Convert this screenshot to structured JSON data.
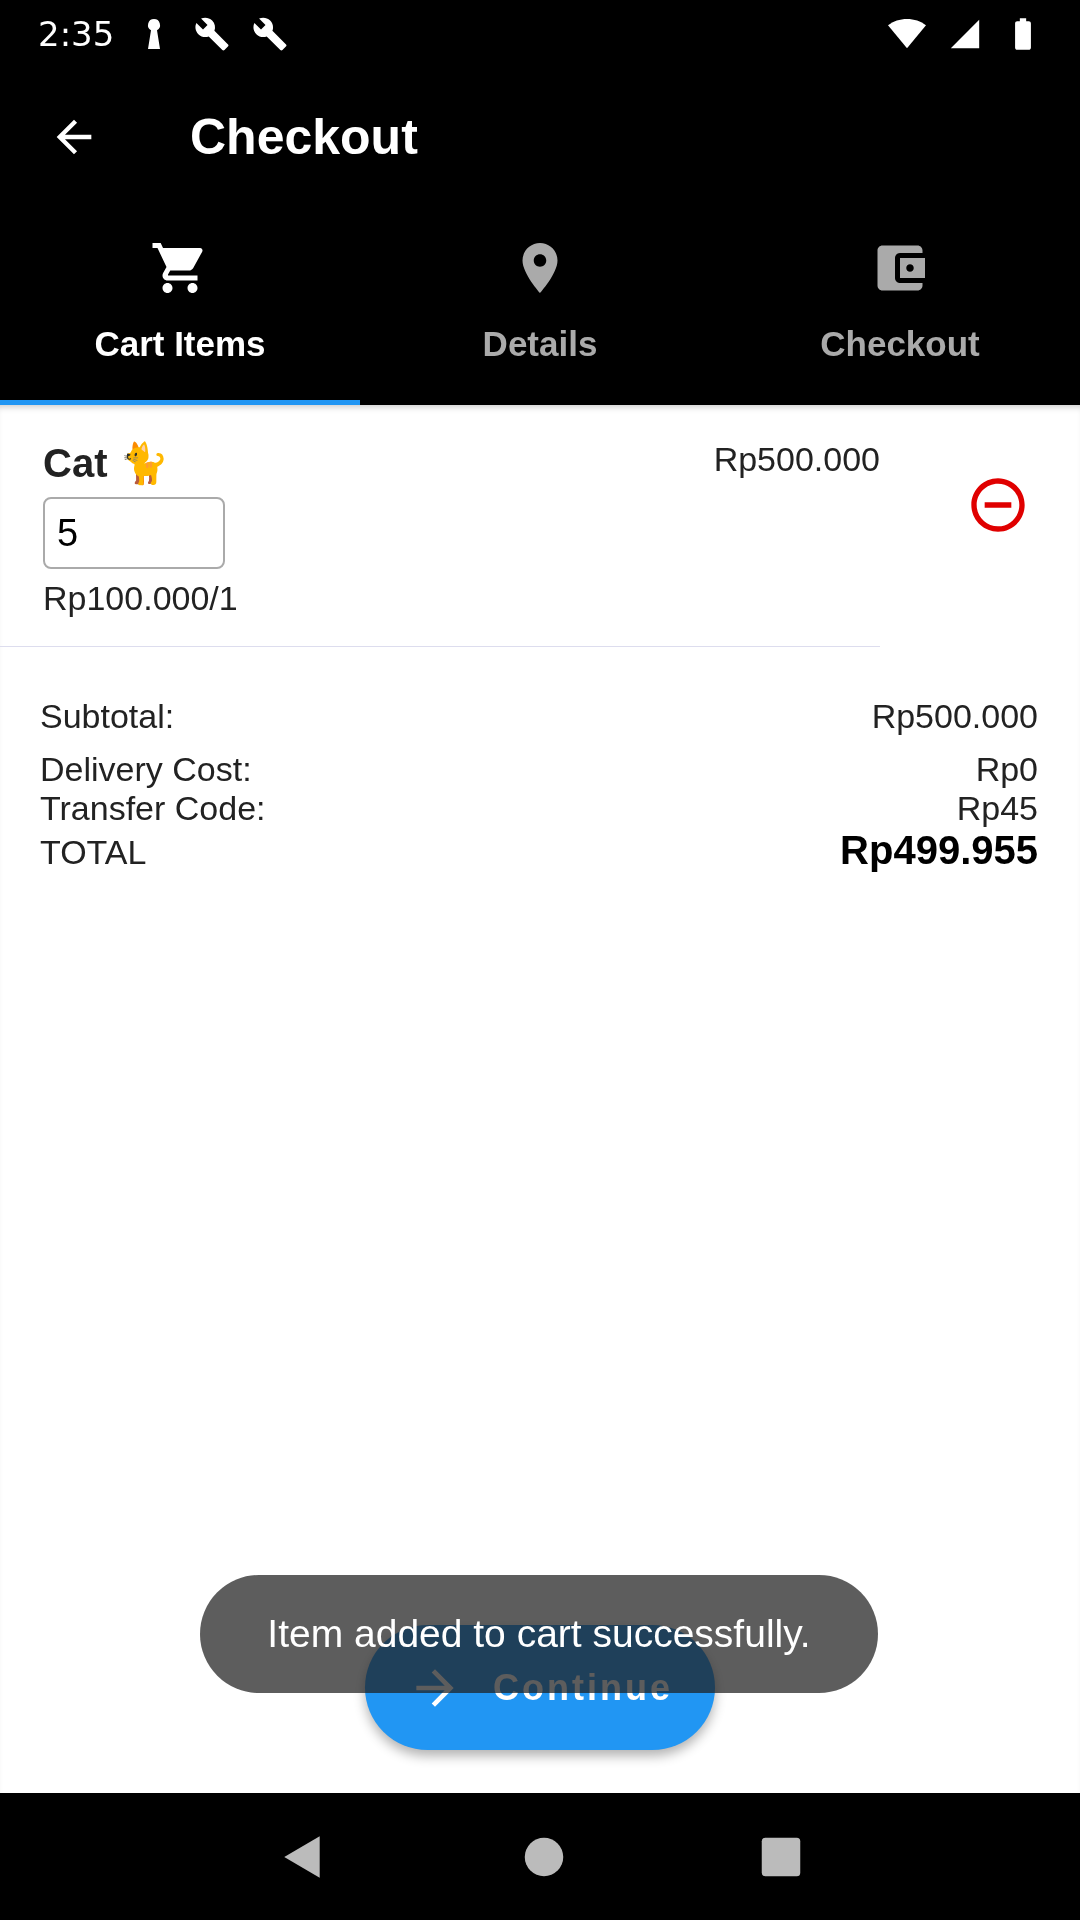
{
  "status_bar": {
    "time": "2:35"
  },
  "app_bar": {
    "title": "Checkout"
  },
  "tabs": [
    {
      "label": "Cart Items",
      "kind": "cart",
      "selected": true
    },
    {
      "label": "Details",
      "kind": "place",
      "selected": false
    },
    {
      "label": "Checkout",
      "kind": "wallet",
      "selected": false
    }
  ],
  "cart_items": [
    {
      "name": "Cat 🐈",
      "quantity": "5",
      "unit_price": "Rp100.000/1",
      "line_total": "Rp500.000"
    }
  ],
  "summary": [
    {
      "kind": "line",
      "label": "Subtotal:",
      "value": "Rp500.000"
    },
    {
      "kind": "line",
      "label": "Delivery Cost:",
      "value": "Rp0"
    },
    {
      "kind": "line",
      "label": "Transfer Code:",
      "value": "Rp45"
    },
    {
      "kind": "total",
      "label": "TOTAL",
      "value": "Rp499.955"
    }
  ],
  "continue_button": {
    "label": "Continue"
  },
  "toast": {
    "message": "Item added to cart successfully."
  }
}
